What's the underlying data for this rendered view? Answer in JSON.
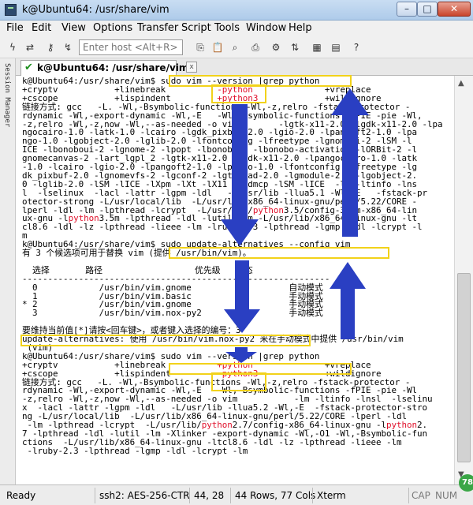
{
  "window": {
    "title": "k@Ubuntu64: /usr/share/vim",
    "minimize": "–",
    "maximize": "□",
    "close": "✕"
  },
  "menu": [
    "File",
    "Edit",
    "View",
    "Options",
    "Transfer",
    "Script",
    "Tools",
    "Window",
    "Help"
  ],
  "toolbar": {
    "host_placeholder": "Enter host <Alt+R>"
  },
  "session_manager": {
    "label": "Session Manager"
  },
  "tab": {
    "label": "k@Ubuntu64: /usr/share/vim",
    "close": "x"
  },
  "terminal": {
    "lines": [
      [
        {
          "t": "k@Ubuntu64:/usr/share/vim$ sudo vim --version |grep python"
        }
      ],
      [
        {
          "t": "+cryptv           +linebreak          "
        },
        {
          "t": "-python",
          "c": "red"
        },
        {
          "t": "              +vreplace"
        }
      ],
      [
        {
          "t": "+cscope           +lispindent         "
        },
        {
          "t": "+python3",
          "c": "red"
        },
        {
          "t": "             +wildignore"
        }
      ],
      [
        {
          "t": "链接方式: gcc   -L. -Wl,-Bsymbolic-functions -Wl,-z,relro -fstack-protector -"
        }
      ],
      [
        {
          "t": "rdynamic -Wl,-export-dynamic -Wl,-E   -Wl,-Bsymbolic-functions -fPIE -pie -Wl,"
        }
      ],
      [
        {
          "t": "-z,relro -Wl,-z,now -Wl,--as-needed -o vim        -lgtk-x11-2.0 -lgdk-x11-2.0 -lpa"
        }
      ],
      [
        {
          "t": "ngocairo-1.0 -latk-1.0 -lcairo -lgdk_pixbuf-2.0 -lgio-2.0 -lpangoft2-1.0 -lpa"
        }
      ],
      [
        {
          "t": "ngo-1.0 -lgobject-2.0 -lglib-2.0 -lfontconfig -lfreetype -lgnomeui-2 -lSM -l"
        }
      ],
      [
        {
          "t": "ICE -lbonoboui-2 -lgnome-2 -lpopt -lbonobo-2 -lbonobo-activation -lORBit-2 -l"
        }
      ],
      [
        {
          "t": "gnomecanvas-2 -lart_lgpl_2 -lgtk-x11-2.0 -lgdk-x11-2.0 -lpangocairo-1.0 -latk"
        }
      ],
      [
        {
          "t": "-1.0 -lcairo -lgio-2.0 -lpangoft2-1.0 -lpango-1.0 -lfontconfig -lfreetype -lg"
        }
      ],
      [
        {
          "t": "dk_pixbuf-2.0 -lgnomevfs-2 -lgconf-2 -lgthread-2.0 -lgmodule-2.0 -lgobject-2."
        }
      ],
      [
        {
          "t": "0 -lglib-2.0 -lSM -lICE -lXpm -lXt -lX11 -lXdmcp -lSM -lICE  -lm -ltinfo -lns"
        }
      ],
      [
        {
          "t": "l  -lselinux  -lacl -lattr -lgpm -ldl   -L/usr/lib -llua5.1 -Wl,-E   -fstack-pr"
        }
      ],
      [
        {
          "t": "otector-strong -L/usr/local/lib  -L/usr/lib/x86_64-linux-gnu/perl/5.22/CORE -"
        }
      ],
      [
        {
          "t": "lperl -ldl -lm -lpthread -lcrypt  -L/usr/lib/"
        },
        {
          "t": "python",
          "c": "red"
        },
        {
          "t": "3.5/config-3.5m-x86_64-lin"
        }
      ],
      [
        {
          "t": "ux-gnu -l"
        },
        {
          "t": "python",
          "c": "red"
        },
        {
          "t": "3.5m -lpthread -ldl -lutil -lm -L/usr/lib/x86_64-linux-gnu -lt"
        }
      ],
      [
        {
          "t": "cl8.6 -ldl -lz -lpthread -lieee -lm -lruby-2.3 -lpthread -lgmp -ldl -lcrypt -l"
        }
      ],
      [
        {
          "t": "m"
        }
      ],
      [
        {
          "t": "k@Ubuntu64:/usr/share/vim$ sudo update-alternatives --config vim"
        }
      ],
      [
        {
          "t": "有 3 个候选项可用于替换 vim (提供 /usr/bin/vim)。"
        }
      ],
      [
        {
          "t": ""
        }
      ],
      [
        {
          "t": "  选择       路径                  优先级   状态"
        }
      ],
      [
        {
          "t": "------------------------------------------------------------"
        }
      ],
      [
        {
          "t": "  0            /usr/bin/vim.gnome         60        自动模式"
        }
      ],
      [
        {
          "t": "  1            /usr/bin/vim.basic         30        手动模式"
        }
      ],
      [
        {
          "t": "* 2            /usr/bin/vim.gnome         60        手动模式"
        }
      ],
      [
        {
          "t": "  3            /usr/bin/vim.nox-py2       59        手动模式"
        }
      ],
      [
        {
          "t": ""
        }
      ],
      [
        {
          "t": "要维持当前值[*]请按<回车键>，或者键入选择的编号：3"
        }
      ],
      [
        {
          "t": "update-alternatives: 使用 /usr/bin/vim.nox-py2 来在手动模式中提供 /usr/bin/vim"
        }
      ],
      [
        {
          "t": " (vim)"
        }
      ],
      [
        {
          "t": "k@Ubuntu64:/usr/share/vim$ sudo vim --version |grep python"
        }
      ],
      [
        {
          "t": "+cryptv           +linebreak          "
        },
        {
          "t": "+python",
          "c": "red"
        },
        {
          "t": "              +vreplace"
        }
      ],
      [
        {
          "t": "+cscope           +lispindent         "
        },
        {
          "t": "-python3",
          "c": "red"
        },
        {
          "t": "             +wildignore"
        }
      ],
      [
        {
          "t": "链接方式: gcc   -L. -Wl,-Bsymbolic-functions -Wl,-z,relro -fstack-protector -"
        }
      ],
      [
        {
          "t": "rdynamic -Wl,-export-dynamic -Wl,-E   -Wl,-Bsymbolic-functions -fPIE -pie -Wl"
        }
      ],
      [
        {
          "t": "-z,relro -Wl,-z,now -Wl,--as-needed -o vim           -lm -ltinfo -lnsl  -lselinu"
        }
      ],
      [
        {
          "t": "x  -lacl -lattr -lgpm -ldl   -L/usr/lib -llua5.2 -Wl,-E  -fstack-protector-stro"
        }
      ],
      [
        {
          "t": "ng -L/usr/local/lib  -L/usr/lib/x86_64-linux-gnu/perl/5.22/CORE -lperl -ldl"
        }
      ],
      [
        {
          "t": " -lm -lpthread -lcrypt  -L/usr/lib/"
        },
        {
          "t": "python",
          "c": "red"
        },
        {
          "t": "2.7/config-x86_64-linux-gnu -l"
        },
        {
          "t": "python",
          "c": "red"
        },
        {
          "t": "2."
        }
      ],
      [
        {
          "t": "7 -lpthread -ldl -lutil -lm -Xlinker -export-dynamic -Wl,-O1 -Wl,-Bsymbolic-fun"
        }
      ],
      [
        {
          "t": "ctions  -L/usr/lib/x86_64-linux-gnu -ltcl8.6 -ldl -lz -lpthread -lieee -lm"
        }
      ],
      [
        {
          "t": " -lruby-2.3 -lpthread -lgmp -ldl -lcrypt -lm"
        }
      ]
    ]
  },
  "status": {
    "ready": "Ready",
    "ssh": "ssh2: AES-256-CTR",
    "cursor": "44,  28",
    "size": "44 Rows, 77 Cols",
    "term": "Xterm",
    "cap": "CAP",
    "num": "NUM"
  },
  "badge": "78",
  "colors": {
    "highlight_box": "#f2d21a",
    "arrow": "#2a3fc2",
    "keyword_red": "#e0102a"
  },
  "icons": [
    "lightning-icon",
    "reconnect-icon",
    "key-icon",
    "copy-icon",
    "paste-icon",
    "find-icon",
    "print-icon",
    "settings-icon",
    "transfer-icon",
    "map-icon",
    "help-icon"
  ]
}
